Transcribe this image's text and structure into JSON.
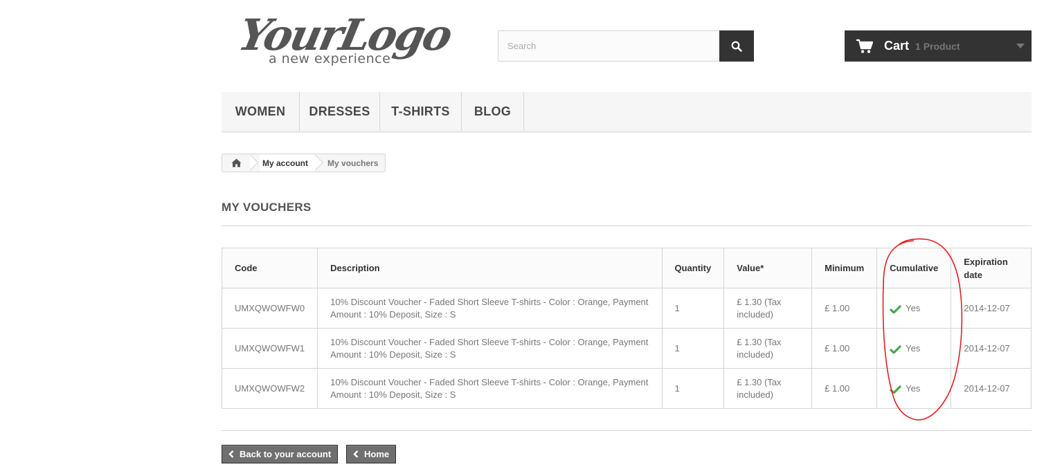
{
  "logo": {
    "main": "YourLogo",
    "tagline": "a new experience"
  },
  "search": {
    "placeholder": "Search"
  },
  "cart": {
    "label": "Cart",
    "count": "1 Product"
  },
  "menu": {
    "items": [
      "WOMEN",
      "DRESSES",
      "T-SHIRTS",
      "BLOG"
    ]
  },
  "breadcrumb": {
    "account": "My account",
    "current": "My vouchers"
  },
  "page": {
    "title": "MY VOUCHERS"
  },
  "table": {
    "headers": {
      "code": "Code",
      "description": "Description",
      "quantity": "Quantity",
      "value": "Value*",
      "minimum": "Minimum",
      "cumulative": "Cumulative",
      "expiration_line1": "Expiration",
      "expiration_line2": "date"
    },
    "rows": [
      {
        "code": "UMXQWOWFW0",
        "desc1": "10% Discount Voucher - Faded Short Sleeve T-shirts - Color : Orange, Payment",
        "desc2": "Amount : 10% Deposit, Size : S",
        "quantity": "1",
        "value1": "£ 1.30 (Tax",
        "value2": "included)",
        "minimum": "£ 1.00",
        "cumulative": "Yes",
        "expiration": "2014-12-07"
      },
      {
        "code": "UMXQWOWFW1",
        "desc1": "10% Discount Voucher - Faded Short Sleeve T-shirts - Color : Orange, Payment",
        "desc2": "Amount : 10% Deposit, Size : S",
        "quantity": "1",
        "value1": "£ 1.30 (Tax",
        "value2": "included)",
        "minimum": "£ 1.00",
        "cumulative": "Yes",
        "expiration": "2014-12-07"
      },
      {
        "code": "UMXQWOWFW2",
        "desc1": "10% Discount Voucher - Faded Short Sleeve T-shirts - Color : Orange, Payment",
        "desc2": "Amount : 10% Deposit, Size : S",
        "quantity": "1",
        "value1": "£ 1.30 (Tax",
        "value2": "included)",
        "minimum": "£ 1.00",
        "cumulative": "Yes",
        "expiration": "2014-12-07"
      }
    ]
  },
  "buttons": {
    "back": "Back to your account",
    "home": "Home"
  },
  "icons": {
    "search": "search-icon",
    "cart": "cart-icon",
    "home": "home-icon",
    "check": "check-icon",
    "chevron": "chevron-left-icon"
  },
  "colors": {
    "dark": "#333333",
    "check_green": "#46a74e",
    "annotation_red": "#e02020"
  }
}
